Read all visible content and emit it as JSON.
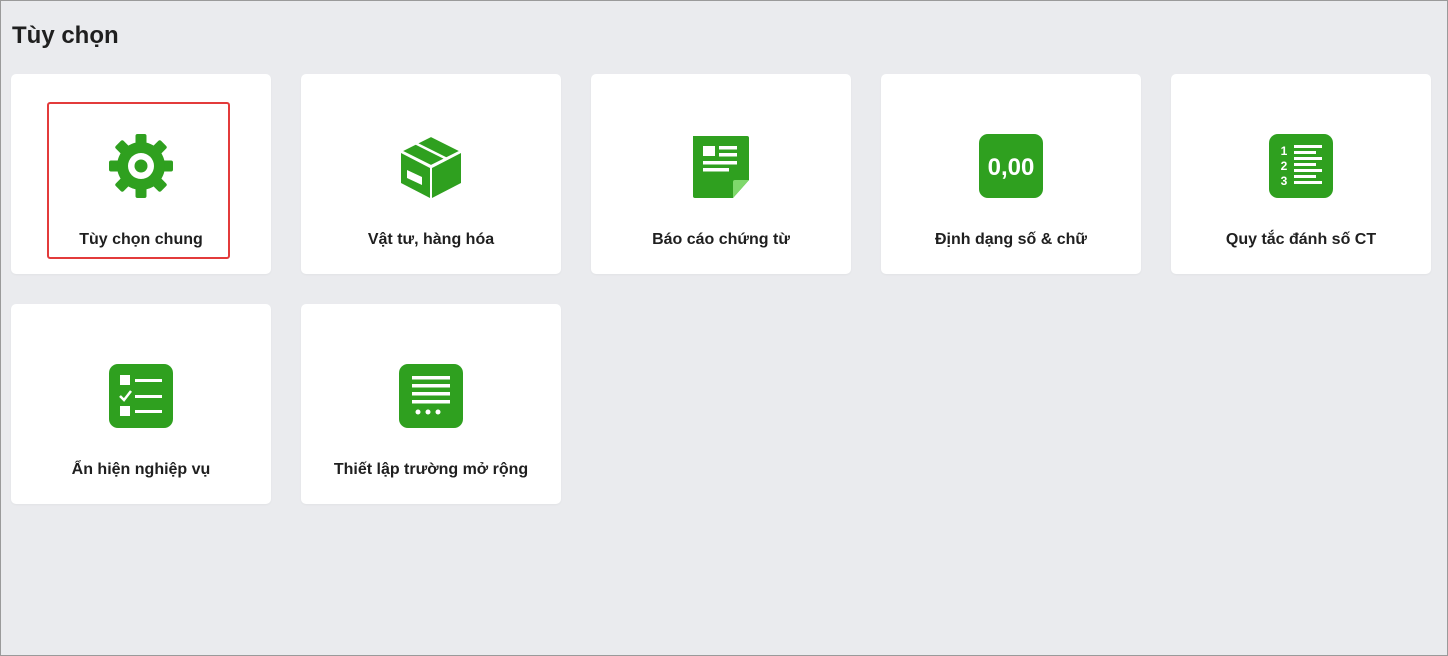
{
  "page": {
    "title": "Tùy chọn"
  },
  "colors": {
    "accent": "#2fa01f",
    "selection": "#e33b3b",
    "background": "#eaebee"
  },
  "options": [
    {
      "label": "Tùy chọn chung",
      "icon": "gear-icon",
      "selected": true
    },
    {
      "label": "Vật tư, hàng hóa",
      "icon": "box-icon",
      "selected": false
    },
    {
      "label": "Báo cáo chứng từ",
      "icon": "document-report-icon",
      "selected": false
    },
    {
      "label": "Định dạng số & chữ",
      "icon": "number-format-icon",
      "icon_text": "0,00",
      "selected": false
    },
    {
      "label": "Quy tắc đánh số CT",
      "icon": "numbered-list-icon",
      "icon_text": [
        "1",
        "2",
        "3"
      ],
      "selected": false
    },
    {
      "label": "Ẩn hiện nghiệp vụ",
      "icon": "checklist-icon",
      "selected": false
    },
    {
      "label": "Thiết lập trường mở rộng",
      "icon": "extended-fields-icon",
      "selected": false
    }
  ]
}
